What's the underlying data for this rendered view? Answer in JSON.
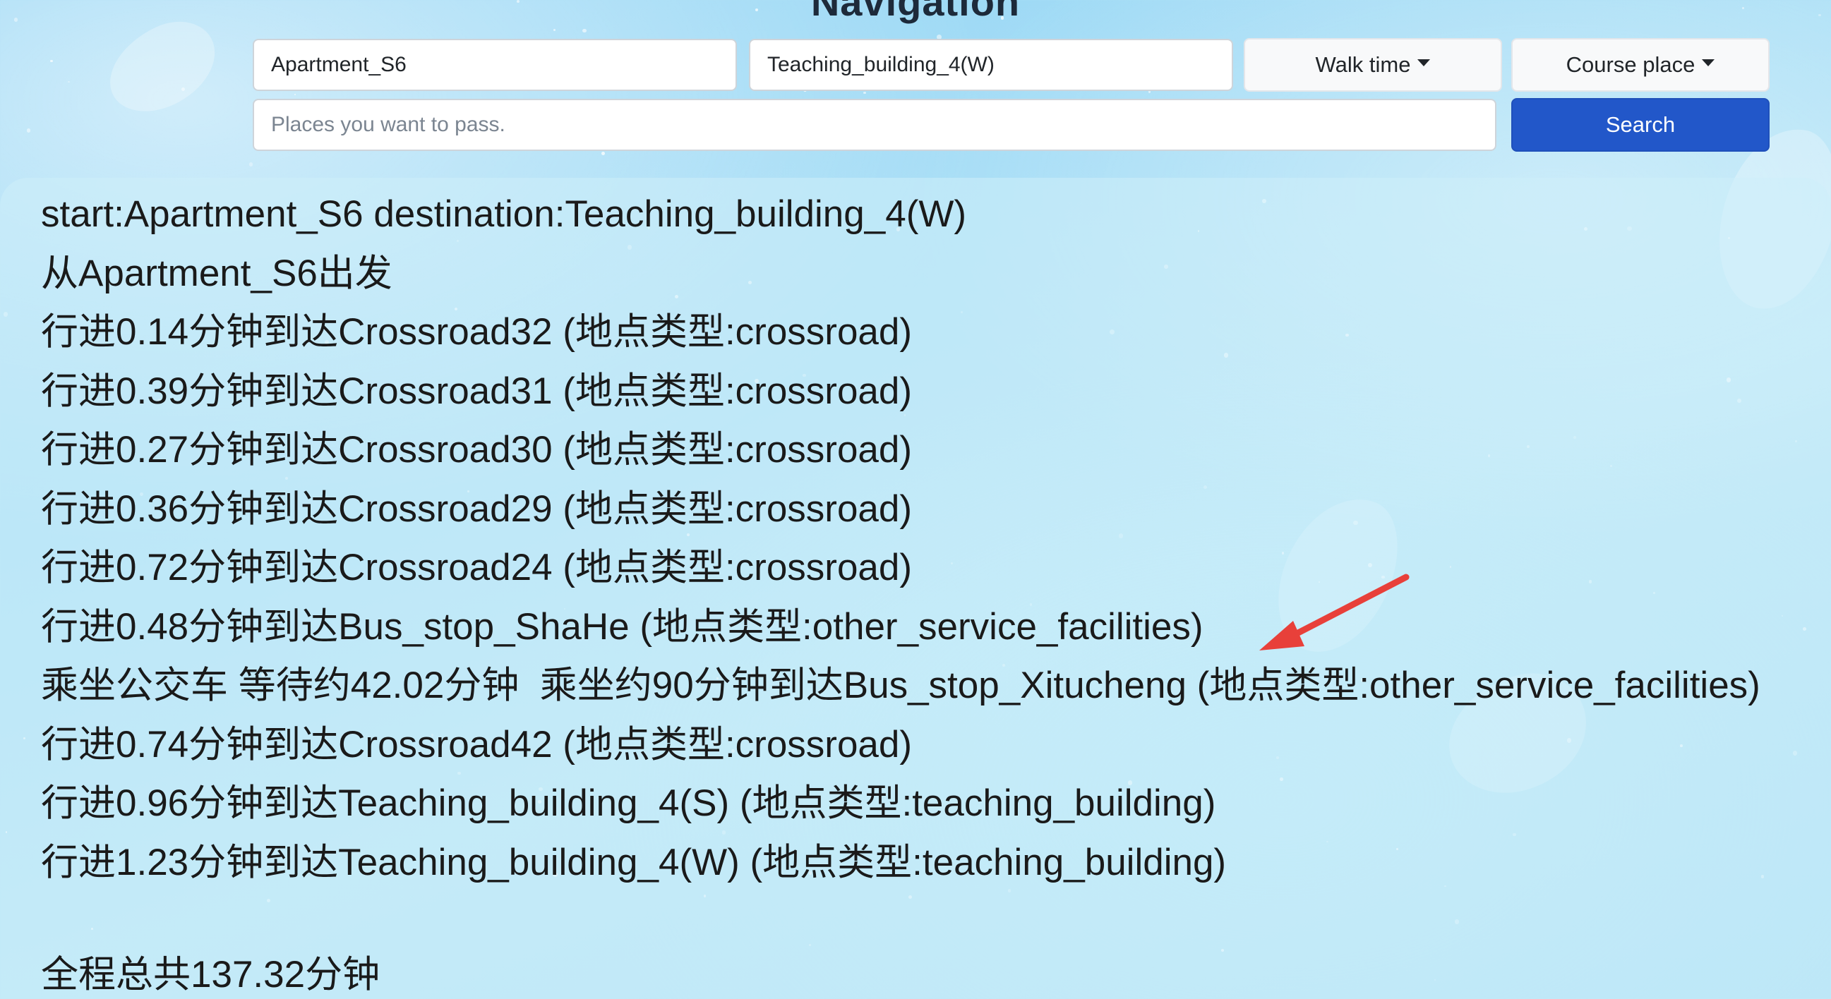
{
  "header": {
    "title": "Navigation"
  },
  "form": {
    "start_value": "Apartment_S6",
    "destination_value": "Teaching_building_4(W)",
    "mode_label": "Walk time",
    "type_label": "Course place",
    "pass_placeholder": "Places you want to pass.",
    "search_label": "Search"
  },
  "result": {
    "lines": [
      "start:Apartment_S6 destination:Teaching_building_4(W)",
      "从Apartment_S6出发",
      "行进0.14分钟到达Crossroad32 (地点类型:crossroad)",
      "行进0.39分钟到达Crossroad31 (地点类型:crossroad)",
      "行进0.27分钟到达Crossroad30 (地点类型:crossroad)",
      "行进0.36分钟到达Crossroad29 (地点类型:crossroad)",
      "行进0.72分钟到达Crossroad24 (地点类型:crossroad)",
      "行进0.48分钟到达Bus_stop_ShaHe (地点类型:other_service_facilities)",
      "乘坐公交车 等待约42.02分钟  乘坐约90分钟到达Bus_stop_Xitucheng (地点类型:other_service_facilities)",
      "行进0.74分钟到达Crossroad42 (地点类型:crossroad)",
      "行进0.96分钟到达Teaching_building_4(S) (地点类型:teaching_building)",
      "行进1.23分钟到达Teaching_building_4(W) (地点类型:teaching_building)"
    ],
    "total": "全程总共137.32分钟"
  },
  "annotation": {
    "arrow_color": "#e8403a"
  }
}
